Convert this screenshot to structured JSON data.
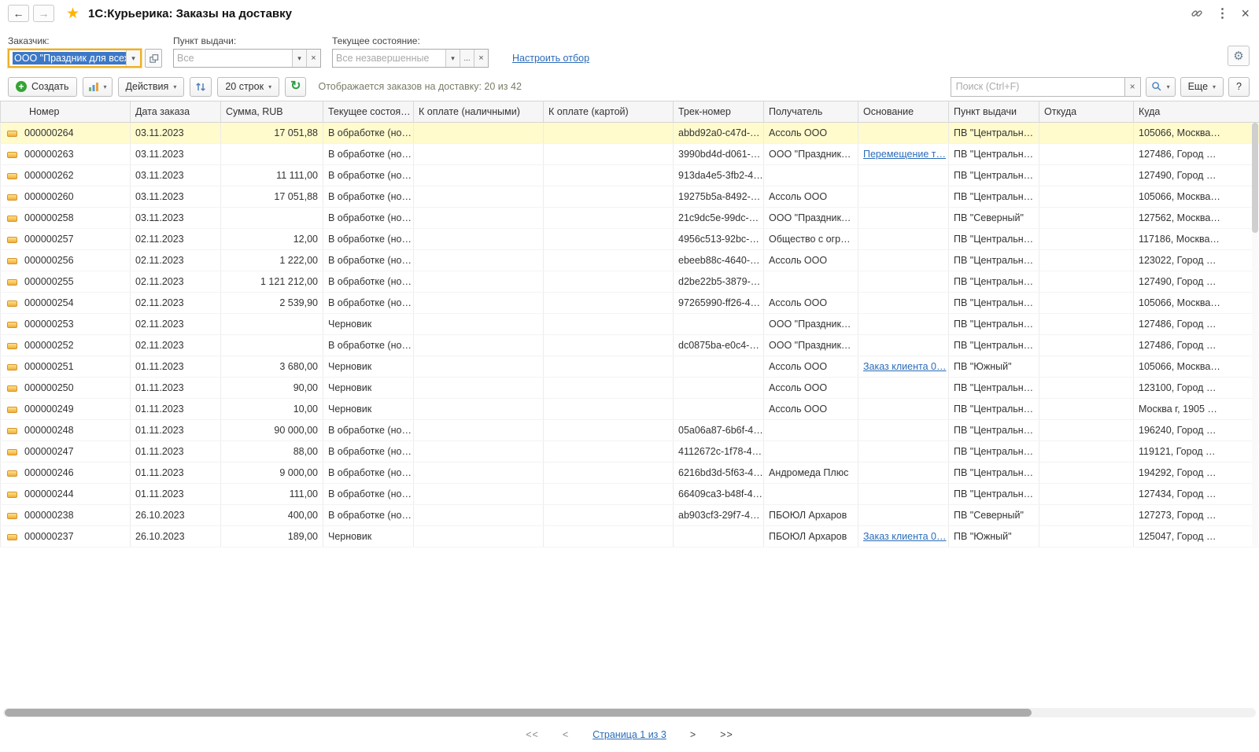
{
  "window": {
    "title": "1С:Курьерика: Заказы на доставку"
  },
  "icons": {
    "back": "←",
    "forward": "→",
    "star": "★",
    "kebab": "⋮",
    "close": "×",
    "caret": "▾",
    "refresh": "↻",
    "gear": "⚙",
    "dots": "...",
    "clear": "×",
    "plus": "+"
  },
  "filters": {
    "customer_label": "Заказчик:",
    "customer_value": "ООО \"Праздник для всех\"",
    "pickup_label": "Пункт выдачи:",
    "pickup_value": "Все",
    "state_label": "Текущее состояние:",
    "state_value": "Все незавершенные",
    "configure_link": "Настроить отбор"
  },
  "toolbar": {
    "create": "Создать",
    "actions": "Действия",
    "rows_count": "20 строк",
    "status": "Отображается заказов на доставку: 20 из 42",
    "search_placeholder": "Поиск (Ctrl+F)",
    "more": "Еще",
    "help": "?"
  },
  "table": {
    "columns": [
      "Номер",
      "Дата заказа",
      "Сумма, RUB",
      "Текущее состоя…",
      "К оплате (наличными)",
      "К оплате (картой)",
      "Трек-номер",
      "Получатель",
      "Основание",
      "Пункт выдачи",
      "Откуда",
      "Куда"
    ],
    "rows": [
      {
        "number": "000000264",
        "date": "03.11.2023",
        "sum": "17 051,88",
        "state": "В обработке (но…",
        "cash": "",
        "card": "",
        "track": "abbd92a0-c47d-…",
        "recipient": "Ассоль ООО",
        "basis": "",
        "pickup": "ПВ \"Центральн…",
        "from": "",
        "to": "105066, Москва…",
        "selected": true
      },
      {
        "number": "000000263",
        "date": "03.11.2023",
        "sum": "",
        "state": "В обработке (но…",
        "cash": "",
        "card": "",
        "track": "3990bd4d-d061-…",
        "recipient": "ООО \"Праздник…",
        "basis": "Перемещение т…",
        "basis_link": true,
        "pickup": "ПВ \"Центральн…",
        "from": "",
        "to": "127486, Город …"
      },
      {
        "number": "000000262",
        "date": "03.11.2023",
        "sum": "11 111,00",
        "state": "В обработке (но…",
        "cash": "",
        "card": "",
        "track": "913da4e5-3fb2-4…",
        "recipient": "",
        "basis": "",
        "pickup": "ПВ \"Центральн…",
        "from": "",
        "to": "127490, Город …"
      },
      {
        "number": "000000260",
        "date": "03.11.2023",
        "sum": "17 051,88",
        "state": "В обработке (но…",
        "cash": "",
        "card": "",
        "track": "19275b5a-8492-…",
        "recipient": "Ассоль ООО",
        "basis": "",
        "pickup": "ПВ \"Центральн…",
        "from": "",
        "to": "105066, Москва…"
      },
      {
        "number": "000000258",
        "date": "03.11.2023",
        "sum": "",
        "state": "В обработке (но…",
        "cash": "",
        "card": "",
        "track": "21c9dc5e-99dc-…",
        "recipient": "ООО \"Праздник…",
        "basis": "",
        "pickup": "ПВ \"Северный\"",
        "from": "",
        "to": "127562, Москва…"
      },
      {
        "number": "000000257",
        "date": "02.11.2023",
        "sum": "12,00",
        "state": "В обработке (но…",
        "cash": "",
        "card": "",
        "track": "4956c513-92bc-…",
        "recipient": "Общество с огр…",
        "basis": "",
        "pickup": "ПВ \"Центральн…",
        "from": "",
        "to": "117186, Москва…"
      },
      {
        "number": "000000256",
        "date": "02.11.2023",
        "sum": "1 222,00",
        "state": "В обработке (но…",
        "cash": "",
        "card": "",
        "track": "ebeeb88c-4640-…",
        "recipient": "Ассоль ООО",
        "basis": "",
        "pickup": "ПВ \"Центральн…",
        "from": "",
        "to": "123022, Город …"
      },
      {
        "number": "000000255",
        "date": "02.11.2023",
        "sum": "1 121 212,00",
        "state": "В обработке (но…",
        "cash": "",
        "card": "",
        "track": "d2be22b5-3879-…",
        "recipient": "",
        "basis": "",
        "pickup": "ПВ \"Центральн…",
        "from": "",
        "to": "127490, Город …"
      },
      {
        "number": "000000254",
        "date": "02.11.2023",
        "sum": "2 539,90",
        "state": "В обработке (но…",
        "cash": "",
        "card": "",
        "track": "97265990-ff26-4…",
        "recipient": "Ассоль ООО",
        "basis": "",
        "pickup": "ПВ \"Центральн…",
        "from": "",
        "to": "105066, Москва…"
      },
      {
        "number": "000000253",
        "date": "02.11.2023",
        "sum": "",
        "state": "Черновик",
        "cash": "",
        "card": "",
        "track": "",
        "recipient": "ООО \"Праздник…",
        "basis": "",
        "pickup": "ПВ \"Центральн…",
        "from": "",
        "to": "127486, Город …"
      },
      {
        "number": "000000252",
        "date": "02.11.2023",
        "sum": "",
        "state": "В обработке (но…",
        "cash": "",
        "card": "",
        "track": "dc0875ba-e0c4-…",
        "recipient": "ООО \"Праздник…",
        "basis": "",
        "pickup": "ПВ \"Центральн…",
        "from": "",
        "to": "127486, Город …"
      },
      {
        "number": "000000251",
        "date": "01.11.2023",
        "sum": "3 680,00",
        "state": "Черновик",
        "cash": "",
        "card": "",
        "track": "",
        "recipient": "Ассоль ООО",
        "basis": "Заказ клиента 0…",
        "basis_link": true,
        "pickup": "ПВ \"Южный\"",
        "from": "",
        "to": "105066, Москва…"
      },
      {
        "number": "000000250",
        "date": "01.11.2023",
        "sum": "90,00",
        "state": "Черновик",
        "cash": "",
        "card": "",
        "track": "",
        "recipient": "Ассоль ООО",
        "basis": "",
        "pickup": "ПВ \"Центральн…",
        "from": "",
        "to": "123100, Город …"
      },
      {
        "number": "000000249",
        "date": "01.11.2023",
        "sum": "10,00",
        "state": "Черновик",
        "cash": "",
        "card": "",
        "track": "",
        "recipient": "Ассоль ООО",
        "basis": "",
        "pickup": "ПВ \"Центральн…",
        "from": "",
        "to": "Москва г, 1905 …"
      },
      {
        "number": "000000248",
        "date": "01.11.2023",
        "sum": "90 000,00",
        "state": "В обработке (но…",
        "cash": "",
        "card": "",
        "track": "05a06a87-6b6f-4…",
        "recipient": "",
        "basis": "",
        "pickup": "ПВ \"Центральн…",
        "from": "",
        "to": "196240, Город …"
      },
      {
        "number": "000000247",
        "date": "01.11.2023",
        "sum": "88,00",
        "state": "В обработке (но…",
        "cash": "",
        "card": "",
        "track": "4112672c-1f78-4…",
        "recipient": "",
        "basis": "",
        "pickup": "ПВ \"Центральн…",
        "from": "",
        "to": "119121, Город …"
      },
      {
        "number": "000000246",
        "date": "01.11.2023",
        "sum": "9 000,00",
        "state": "В обработке (но…",
        "cash": "",
        "card": "",
        "track": "6216bd3d-5f63-4…",
        "recipient": "Андромеда Плюс",
        "basis": "",
        "pickup": "ПВ \"Центральн…",
        "from": "",
        "to": "194292, Город …"
      },
      {
        "number": "000000244",
        "date": "01.11.2023",
        "sum": "111,00",
        "state": "В обработке (но…",
        "cash": "",
        "card": "",
        "track": "66409ca3-b48f-4…",
        "recipient": "",
        "basis": "",
        "pickup": "ПВ \"Центральн…",
        "from": "",
        "to": "127434, Город …"
      },
      {
        "number": "000000238",
        "date": "26.10.2023",
        "sum": "400,00",
        "state": "В обработке (но…",
        "cash": "",
        "card": "",
        "track": "ab903cf3-29f7-4…",
        "recipient": "ПБОЮЛ Архаров",
        "basis": "",
        "pickup": "ПВ \"Северный\"",
        "from": "",
        "to": "127273, Город …"
      },
      {
        "number": "000000237",
        "date": "26.10.2023",
        "sum": "189,00",
        "state": "Черновик",
        "cash": "",
        "card": "",
        "track": "",
        "recipient": "ПБОЮЛ Архаров",
        "basis": "Заказ клиента 0…",
        "basis_link": true,
        "pickup": "ПВ \"Южный\"",
        "from": "",
        "to": "125047, Город …"
      }
    ]
  },
  "pagination": {
    "first": "<<",
    "prev": "<",
    "label": "Страница 1 из 3",
    "next": ">",
    "last": ">>"
  }
}
